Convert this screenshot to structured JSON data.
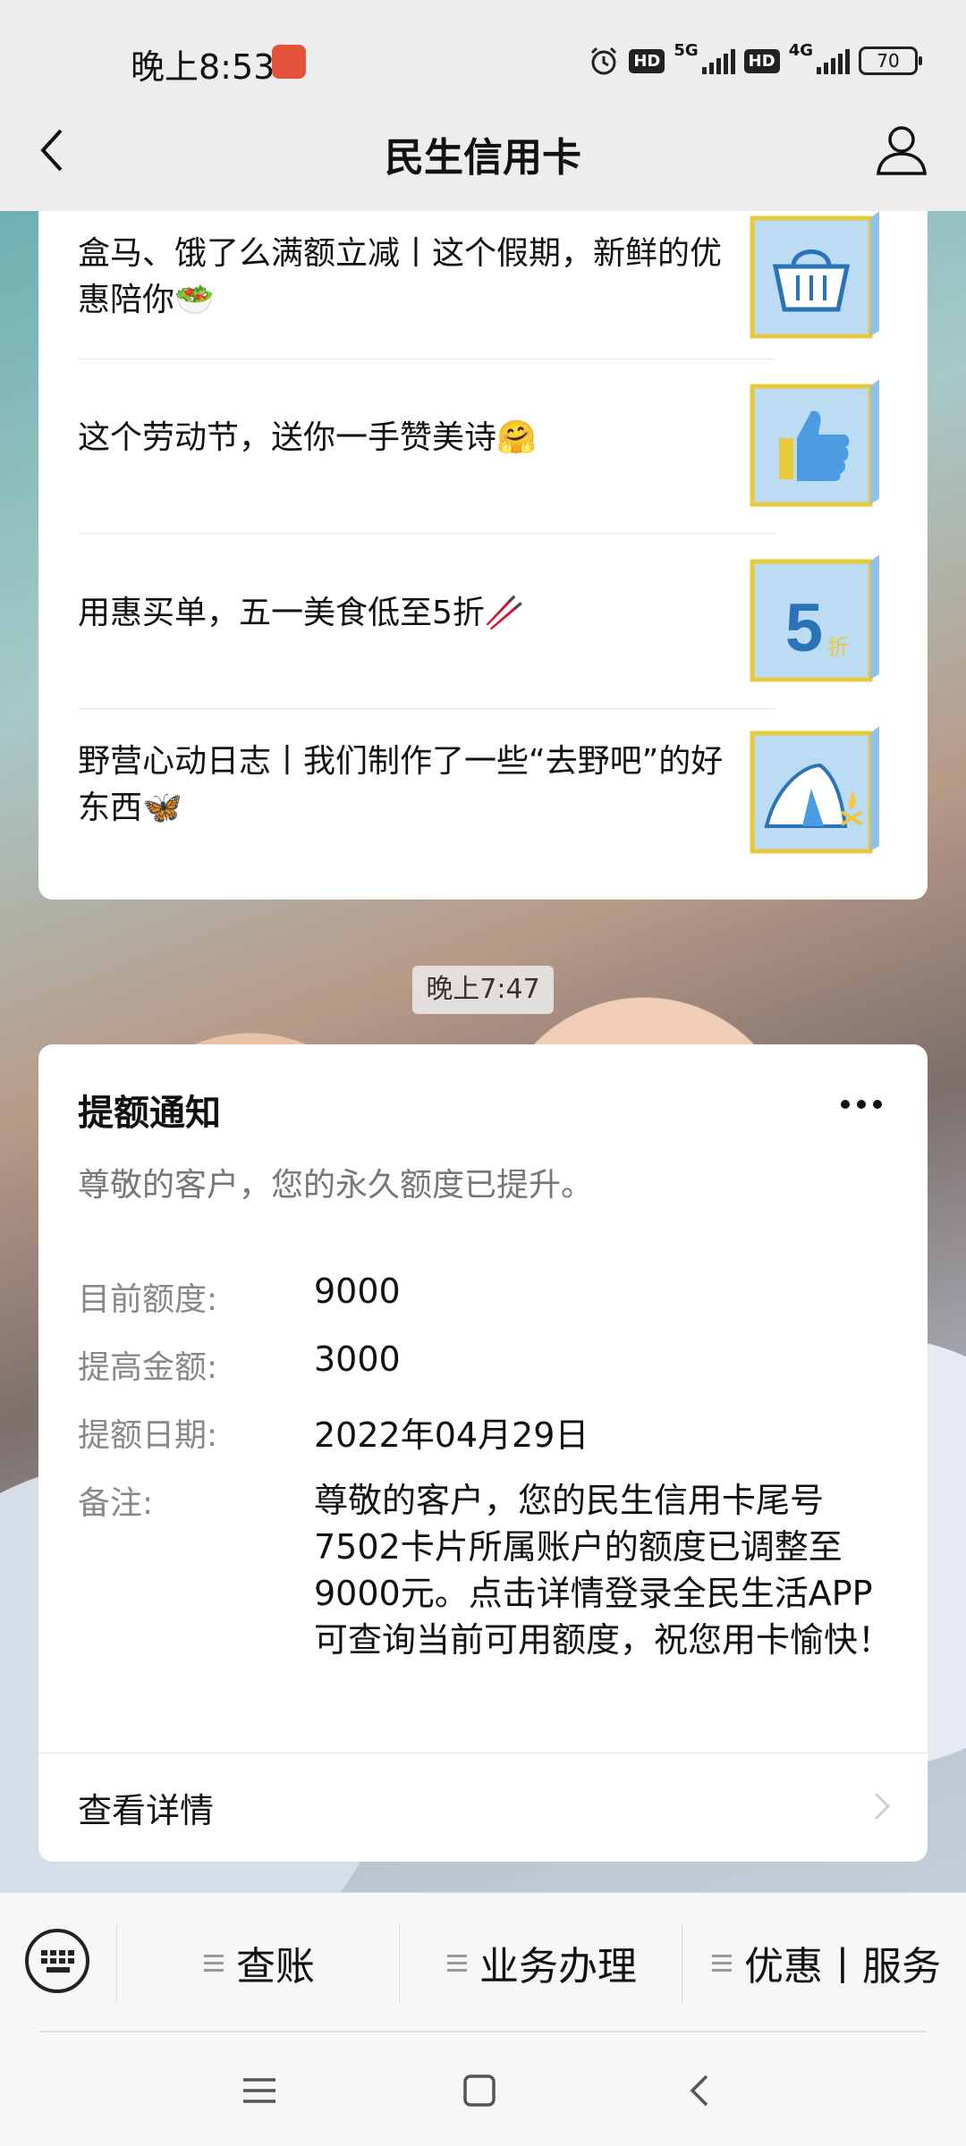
{
  "status_bar": {
    "time": "晚上8:53",
    "network_1": "5G",
    "network_2": "4G",
    "hd": "HD",
    "battery": "70"
  },
  "header": {
    "title": "民生信用卡"
  },
  "articles": [
    {
      "text": "盒马、饿了么满额立减丨这个假期，新鲜的优惠陪你🥗",
      "thumb": "basket-icon"
    },
    {
      "text": "这个劳动节，送你一手赞美诗🤗",
      "thumb": "thumbs-up-icon"
    },
    {
      "text": "用惠买单，五一美食低至5折🥢",
      "thumb": "discount-icon",
      "thumb_big": "5",
      "thumb_small": "折"
    },
    {
      "text": "野营心动日志丨我们制作了一些“去野吧”的好东西🦋",
      "thumb": "tent-icon"
    }
  ],
  "timestamp": "晚上7:47",
  "notice": {
    "title": "提额通知",
    "subtitle": "尊敬的客户，您的永久额度已提升。",
    "fields": [
      {
        "label": "目前额度:",
        "value": "9000"
      },
      {
        "label": "提高金额:",
        "value": "3000"
      },
      {
        "label": "提额日期:",
        "value": "2022年04月29日"
      },
      {
        "label": "备注:",
        "value": "尊敬的客户，您的民生信用卡尾号7502卡片所属账户的额度已调整至9000元。点击详情登录全民生活APP可查询当前可用额度，祝您用卡愉快！"
      }
    ],
    "detail_label": "查看详情"
  },
  "menu": {
    "items": [
      "查账",
      "业务办理",
      "优惠丨服务"
    ]
  },
  "colors": {
    "background": "#ededed",
    "card": "#ffffff",
    "thumb_fill": "#bcdcf4",
    "thumb_border": "#e8c93a"
  }
}
